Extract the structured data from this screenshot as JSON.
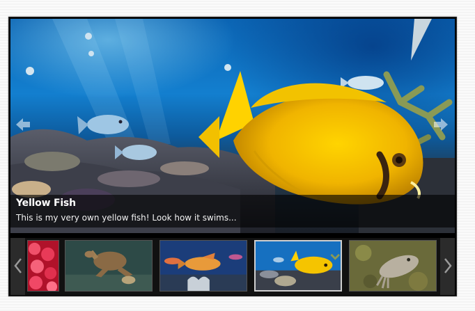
{
  "slideshow": {
    "current_slide": {
      "title": "Yellow Fish",
      "description": "This is my very own yellow fish! Look how it swims..."
    },
    "nav": {
      "prev_icon": "arrow-left-icon",
      "next_icon": "arrow-right-icon"
    }
  },
  "thumbnails": {
    "prev_icon": "chevron-left-icon",
    "next_icon": "chevron-right-icon",
    "active_index": 3,
    "items": [
      {
        "subject": "red coral"
      },
      {
        "subject": "sea turtle"
      },
      {
        "subject": "orange fish"
      },
      {
        "subject": "yellow fish"
      },
      {
        "subject": "cuttlefish"
      }
    ]
  },
  "colors": {
    "frame": "#000000",
    "caption_bg": "rgba(0,0,0,0.62)",
    "water": "#137fcf",
    "fish": "#f5c400",
    "active_border": "#cfcfcf"
  }
}
